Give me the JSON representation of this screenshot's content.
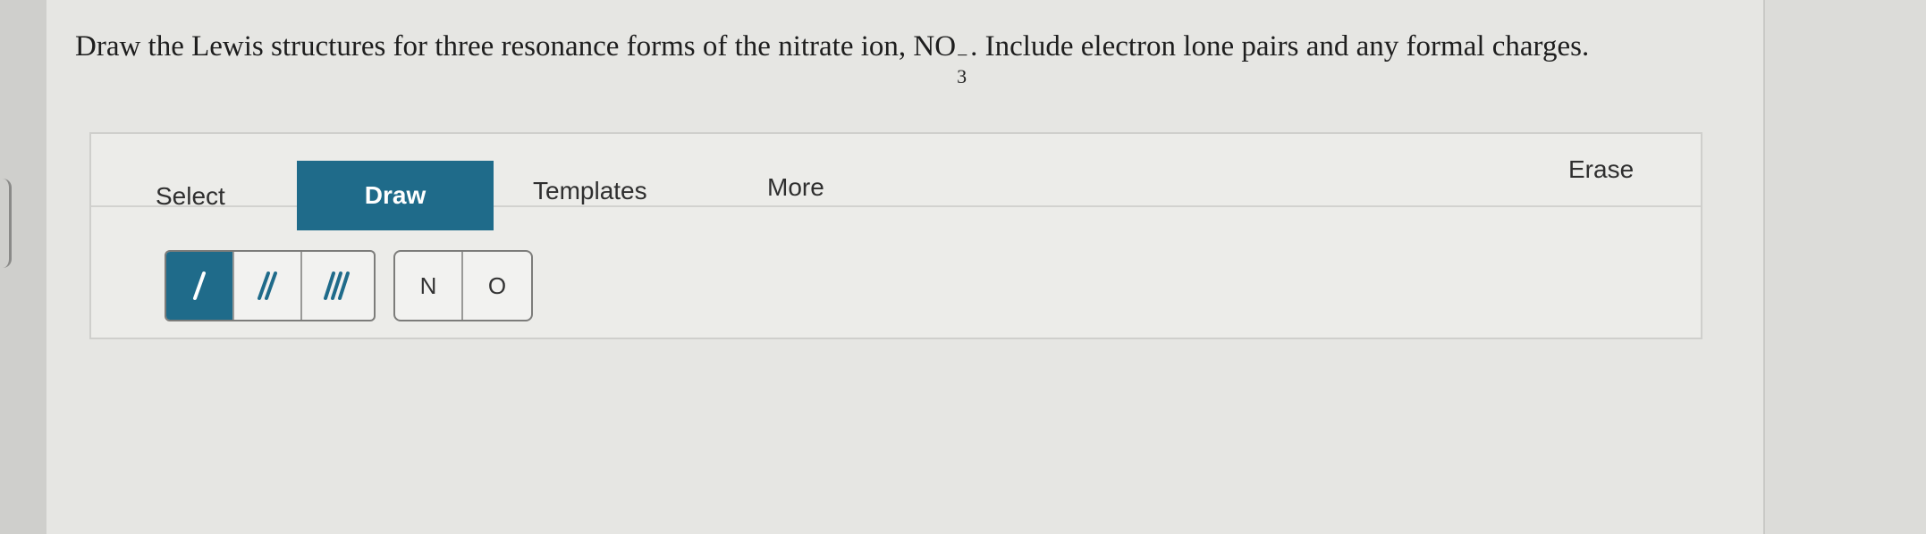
{
  "question": {
    "text_before": "Draw the Lewis structures for three resonance forms of the nitrate ion, ",
    "formula_base": "NO",
    "formula_sub": "3",
    "formula_sup": "−",
    "text_after": ". Include electron lone pairs and any formal charges."
  },
  "toolbar": {
    "tabs": [
      {
        "label": "Select"
      },
      {
        "label": "Draw",
        "active": true
      },
      {
        "label": "Templates"
      },
      {
        "label": "More"
      }
    ],
    "erase_label": "Erase"
  },
  "bonds": {
    "items": [
      {
        "icon": "single-bond-icon",
        "active": true
      },
      {
        "icon": "double-bond-icon"
      },
      {
        "icon": "triple-bond-icon"
      }
    ]
  },
  "atoms": {
    "items": [
      {
        "label": "N"
      },
      {
        "label": "O"
      }
    ]
  },
  "colors": {
    "accent": "#1f6b8a"
  }
}
